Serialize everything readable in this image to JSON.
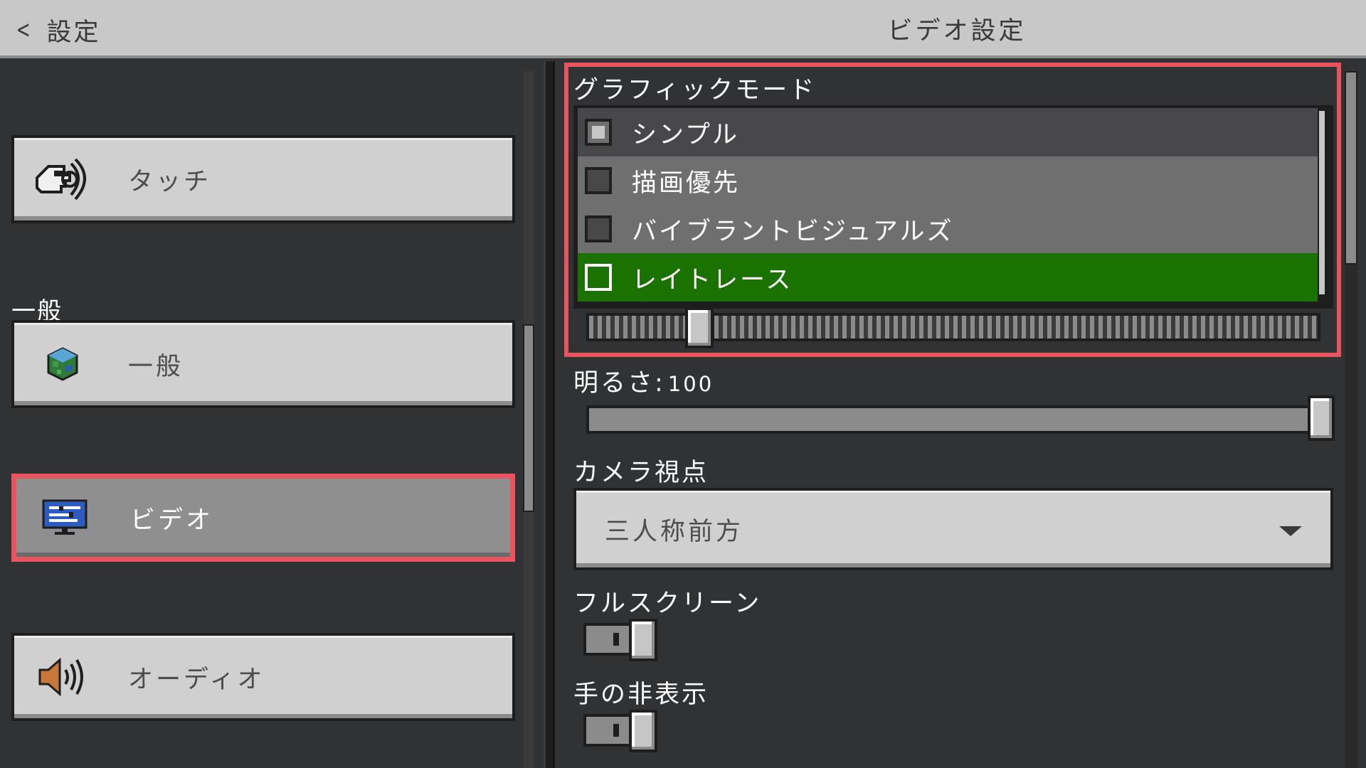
{
  "header": {
    "back_label": "設定",
    "title": "ビデオ設定"
  },
  "sidebar": {
    "section_label": "一般",
    "items": [
      {
        "label": "タッチ",
        "icon": "touch-hand-icon"
      },
      {
        "label": "一般",
        "icon": "globe-cube-icon"
      },
      {
        "label": "ビデオ",
        "icon": "monitor-icon",
        "selected": true
      },
      {
        "label": "オーディオ",
        "icon": "speaker-icon"
      }
    ]
  },
  "graphics_mode": {
    "title": "グラフィックモード",
    "options": [
      {
        "label": "シンプル",
        "state": "hover"
      },
      {
        "label": "描画優先",
        "state": "normal"
      },
      {
        "label": "バイブラントビジュアルズ",
        "state": "normal"
      },
      {
        "label": "レイトレース",
        "state": "active"
      }
    ],
    "slider_value_fraction": 0.15
  },
  "brightness": {
    "label": "明るさ:",
    "value": "100"
  },
  "camera": {
    "label": "カメラ視点",
    "value": "三人称前方"
  },
  "fullscreen": {
    "label": "フルスクリーン",
    "on": false
  },
  "hide_hand": {
    "label": "手の非表示",
    "on": false
  },
  "colors": {
    "accent_highlight": "#e8535e",
    "active_green": "#1a7200"
  }
}
